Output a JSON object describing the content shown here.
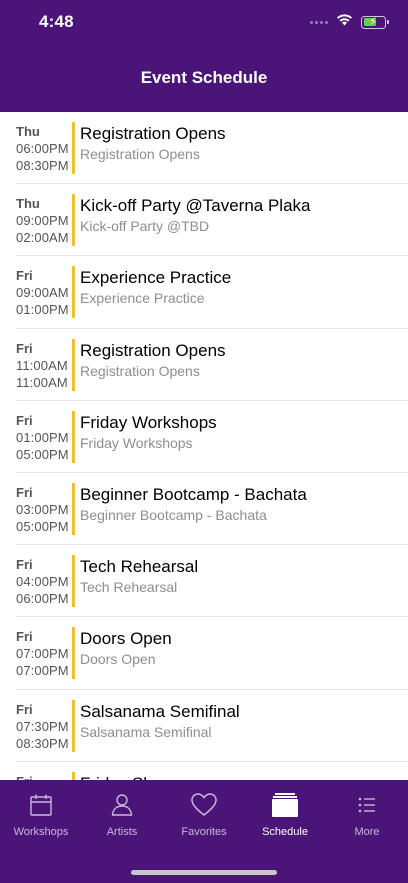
{
  "status": {
    "time": "4:48"
  },
  "header": {
    "title": "Event Schedule"
  },
  "events": [
    {
      "day": "Thu",
      "start": "06:00PM",
      "end": "08:30PM",
      "title": "Registration Opens",
      "subtitle": "Registration Opens"
    },
    {
      "day": "Thu",
      "start": "09:00PM",
      "end": "02:00AM",
      "title": "Kick-off Party @Taverna Plaka",
      "subtitle": "Kick-off Party @TBD"
    },
    {
      "day": "Fri",
      "start": "09:00AM",
      "end": "01:00PM",
      "title": "Experience Practice",
      "subtitle": "Experience Practice"
    },
    {
      "day": "Fri",
      "start": "11:00AM",
      "end": "11:00AM",
      "title": "Registration Opens",
      "subtitle": "Registration Opens"
    },
    {
      "day": "Fri",
      "start": "01:00PM",
      "end": "05:00PM",
      "title": "Friday Workshops",
      "subtitle": "Friday Workshops"
    },
    {
      "day": "Fri",
      "start": "03:00PM",
      "end": "05:00PM",
      "title": "Beginner Bootcamp - Bachata",
      "subtitle": "Beginner Bootcamp - Bachata"
    },
    {
      "day": "Fri",
      "start": "04:00PM",
      "end": "06:00PM",
      "title": "Tech Rehearsal",
      "subtitle": "Tech Rehearsal"
    },
    {
      "day": "Fri",
      "start": "07:00PM",
      "end": "07:00PM",
      "title": "Doors Open",
      "subtitle": "Doors Open"
    },
    {
      "day": "Fri",
      "start": "07:30PM",
      "end": "08:30PM",
      "title": "Salsanama Semifinal",
      "subtitle": "Salsanama Semifinal"
    },
    {
      "day": "Fri",
      "start": "",
      "end": "",
      "title": "Friday Shows",
      "subtitle": ""
    }
  ],
  "tabs": [
    {
      "label": "Workshops",
      "icon": "calendar-icon",
      "active": false
    },
    {
      "label": "Artists",
      "icon": "person-icon",
      "active": false
    },
    {
      "label": "Favorites",
      "icon": "heart-icon",
      "active": false
    },
    {
      "label": "Schedule",
      "icon": "schedule-icon",
      "active": true
    },
    {
      "label": "More",
      "icon": "list-icon",
      "active": false
    }
  ],
  "colors": {
    "brand": "#4b1478",
    "accent_bar": "#f0c030",
    "tab_inactive": "#c9b8da",
    "tab_active": "#ffffff"
  }
}
